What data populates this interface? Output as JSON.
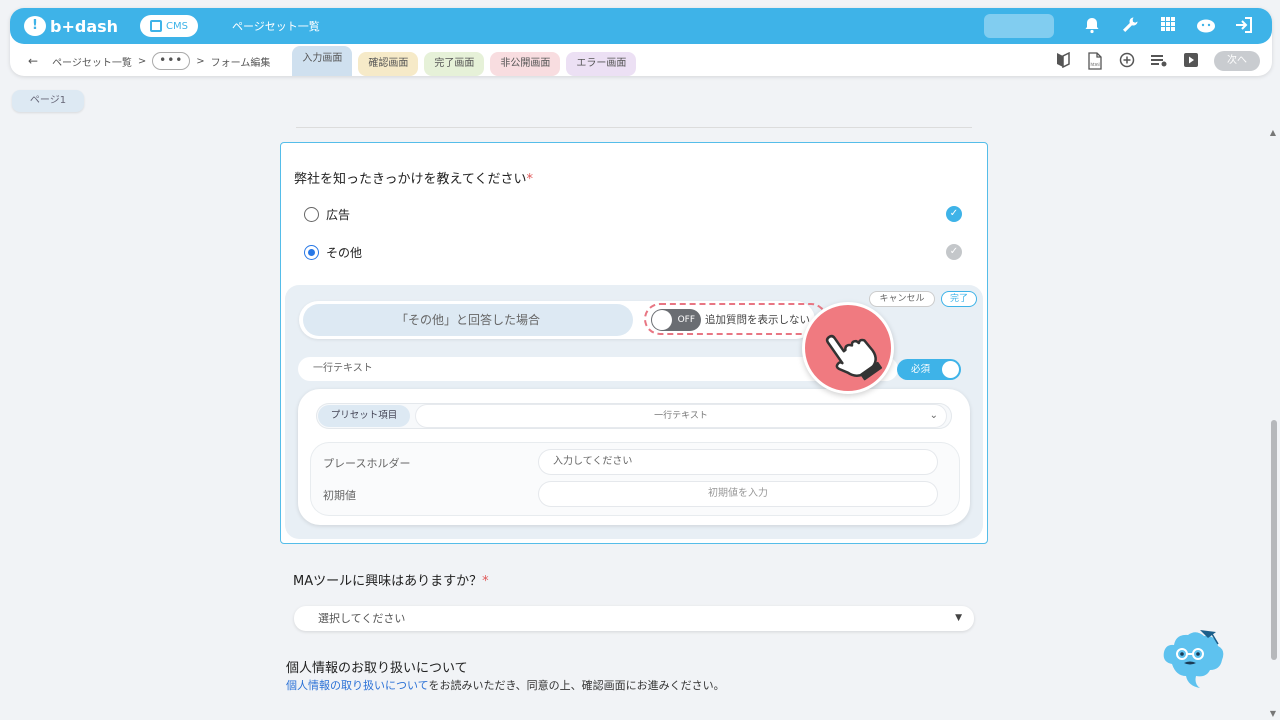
{
  "header": {
    "logo_text": "b+dash",
    "cms_label": "CMS",
    "title": "ページセット一覧",
    "icons": [
      "bell-icon",
      "wrench-icon",
      "grid-icon",
      "cloud-avatar-icon",
      "logout-icon"
    ]
  },
  "subbar": {
    "back_symbol": "←",
    "crumb1": "ページセット一覧",
    "crumb_sep": ">",
    "dots": "•••",
    "crumb2": "フォーム編集",
    "tabs": [
      "入力画面",
      "確認画面",
      "完了画面",
      "非公開画面",
      "エラー画面"
    ],
    "next_label": "次へ"
  },
  "page_chip": "ページ1",
  "question1": {
    "title": "弊社を知ったきっかけを教えてください",
    "required_mark": "*",
    "options": [
      {
        "label": "広告",
        "selected": false
      },
      {
        "label": "その他",
        "selected": true
      }
    ],
    "check_mark": "✓"
  },
  "followup": {
    "cancel_label": "キャンセル",
    "done_label": "完了",
    "condition_label": "「その他」と回答した場合",
    "toggle_label": "OFF",
    "toggle_note": "追加質問を表示しない",
    "field_type": "一行テキスト",
    "required_label": "必須",
    "preset_label": "プリセット項目",
    "preset_value": "一行テキスト",
    "placeholder_label": "プレースホルダー",
    "placeholder_value": "入力してください",
    "default_label": "初期値",
    "default_placeholder": "初期値を入力"
  },
  "question2": {
    "title": "MAツールに興味はありますか？",
    "required_mark": "*",
    "select_placeholder": "選択してください"
  },
  "privacy": {
    "title": "個人情報のお取り扱いについて",
    "link_text": "個人情報の取り扱いについて",
    "body_text": "をお読みいただき、同意の上、確認画面にお進みください。"
  },
  "colors": {
    "brand": "#3eb3e8",
    "accent_pink": "#f07a80",
    "radio_selected": "#2878e6"
  }
}
